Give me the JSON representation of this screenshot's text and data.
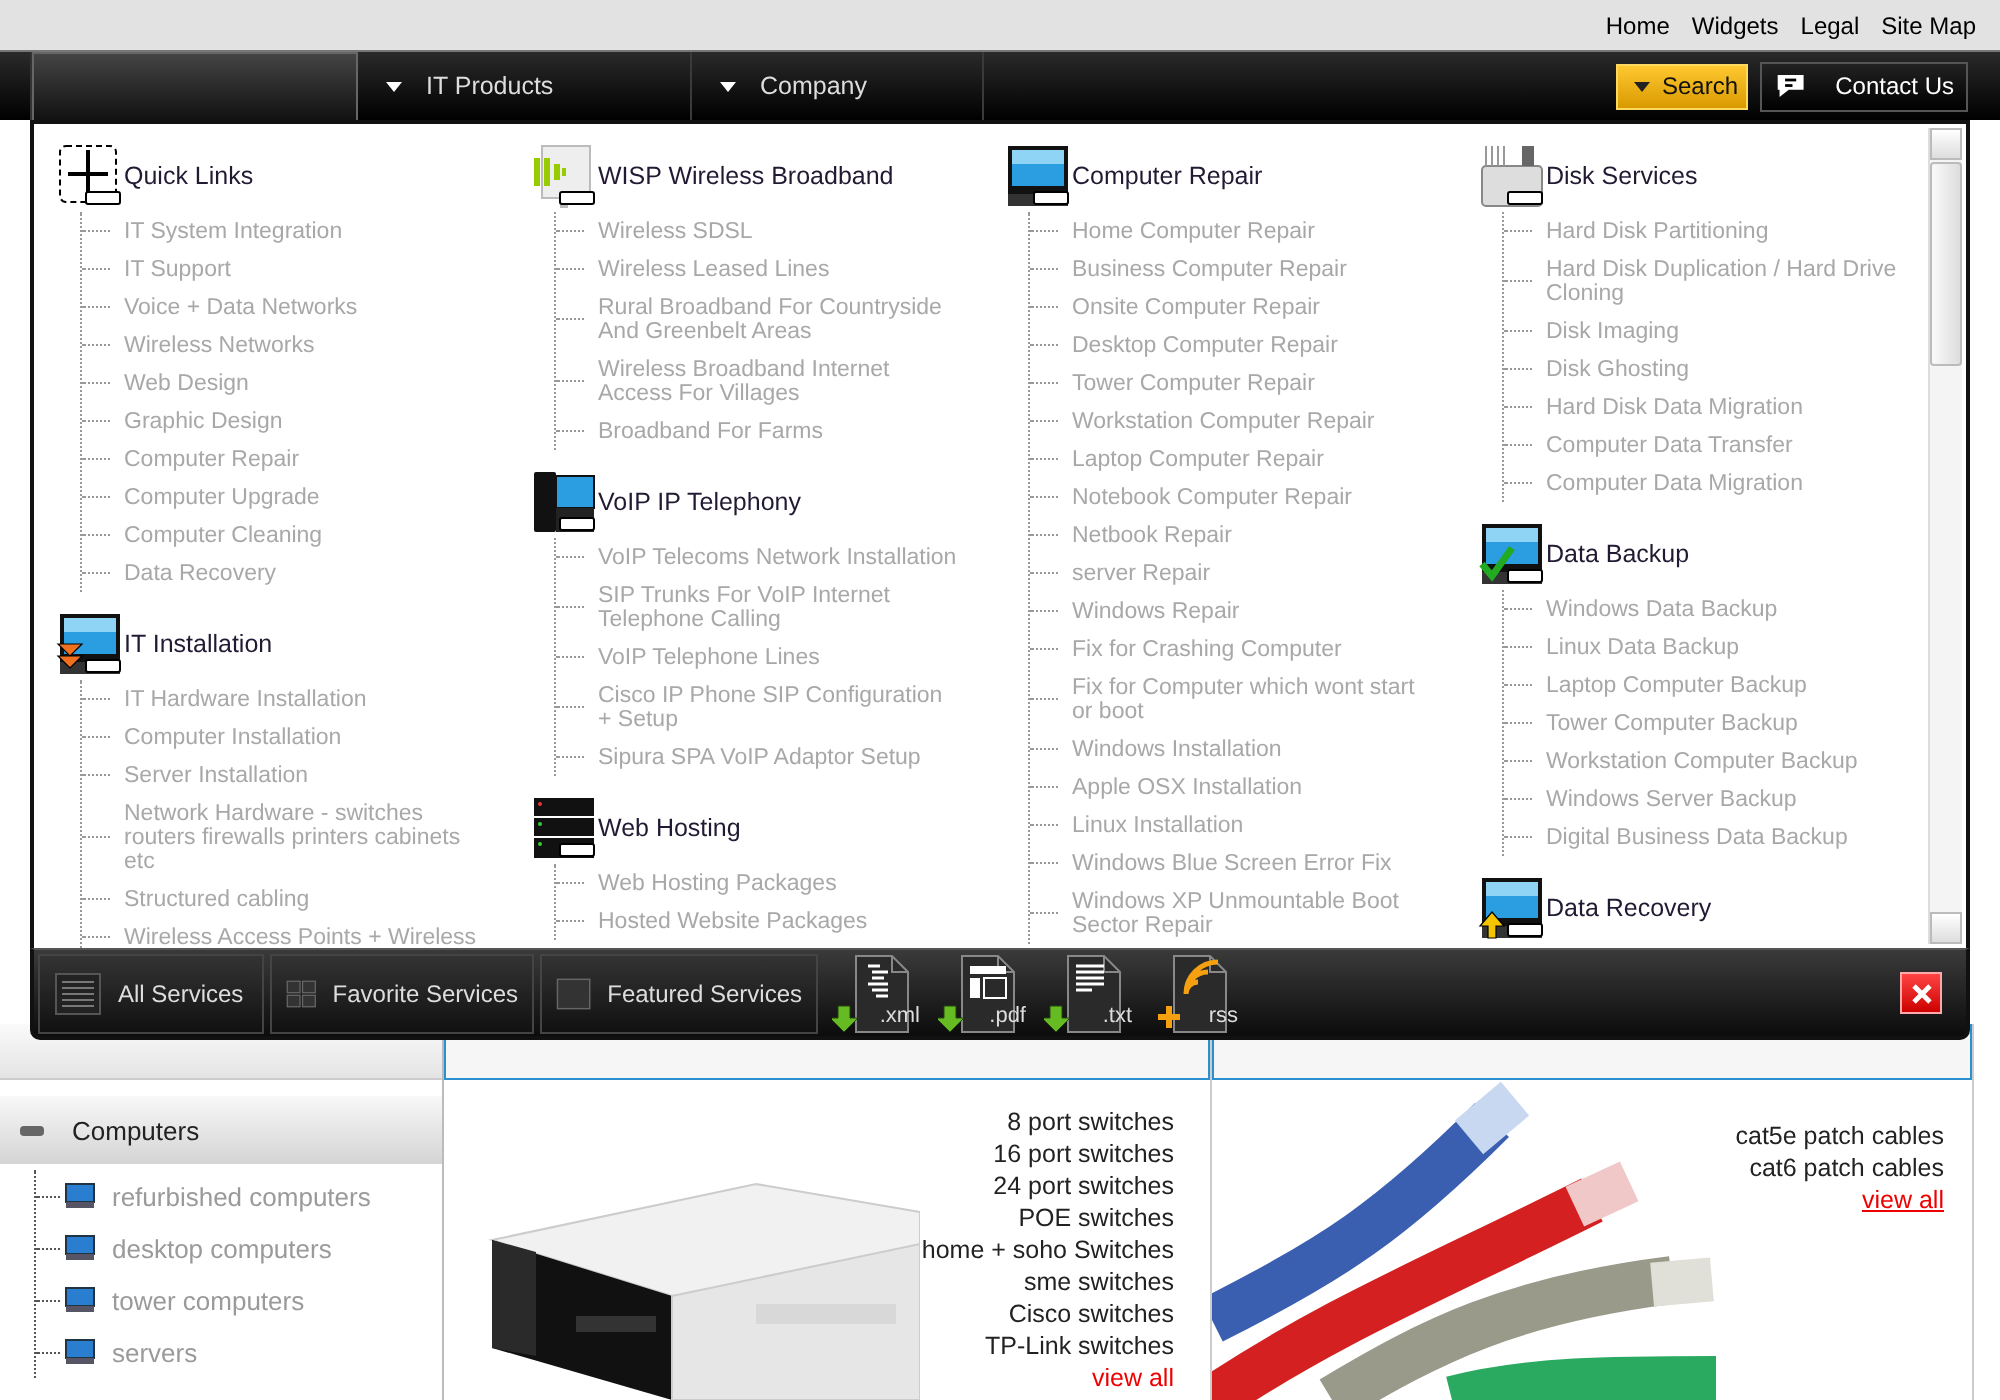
{
  "top_links": [
    "Home",
    "Widgets",
    "Legal",
    "Site Map"
  ],
  "nav": {
    "tabs": [
      {
        "selected": true
      },
      {
        "label": "IT Products",
        "selected": false
      },
      {
        "label": "Company",
        "selected": false
      }
    ],
    "search_button": "Search",
    "contact_button": "Contact Us"
  },
  "menu": {
    "columns": [
      [
        {
          "kind": "links",
          "title": "Quick Links",
          "items": [
            "IT System Integration",
            "IT Support",
            "Voice + Data Networks",
            "Wireless Networks",
            "Web Design",
            "Graphic Design",
            "Computer Repair",
            "Computer Upgrade",
            "Computer Cleaning",
            "Data Recovery"
          ]
        },
        {
          "kind": "install",
          "title": "IT Installation",
          "items": [
            "IT Hardware Installation",
            "Computer Installation",
            "Server Installation",
            "Network Hardware - switches routers firewalls printers cabinets etc",
            "Structured cabling",
            "Wireless Access Points + Wireless"
          ]
        }
      ],
      [
        {
          "kind": "wireless",
          "title": "WISP Wireless Broadband",
          "items": [
            "Wireless SDSL",
            "Wireless Leased Lines",
            "Rural Broadband For Countryside And Greenbelt Areas",
            "Wireless Broadband Internet Access For Villages",
            "Broadband For Farms"
          ]
        },
        {
          "kind": "phone",
          "title": "VoIP IP Telephony",
          "items": [
            "VoIP Telecoms Network Installation",
            "SIP Trunks For VoIP Internet Telephone Calling",
            "VoIP Telephone Lines",
            "Cisco IP Phone SIP Configuration + Setup",
            "Sipura SPA VoIP Adaptor Setup"
          ]
        },
        {
          "kind": "server",
          "title": "Web Hosting",
          "items": [
            "Web Hosting Packages",
            "Hosted Website Packages"
          ]
        }
      ],
      [
        {
          "kind": "monitor",
          "title": "Computer Repair",
          "items": [
            "Home Computer Repair",
            "Business Computer Repair",
            "Onsite Computer Repair",
            "Desktop Computer Repair",
            "Tower Computer Repair",
            "Workstation Computer Repair",
            "Laptop Computer Repair",
            "Notebook Computer Repair",
            "Netbook Repair",
            "server Repair",
            "Windows Repair",
            "Fix for Crashing Computer",
            "Fix for Computer which wont start or boot",
            "Windows Installation",
            "Apple OSX Installation",
            "Linux Installation",
            "Windows Blue Screen Error Fix",
            "Windows XP Unmountable Boot Sector Repair"
          ]
        }
      ],
      [
        {
          "kind": "disk",
          "title": "Disk Services",
          "items": [
            "Hard Disk Partitioning",
            "Hard Disk Duplication / Hard Drive Cloning",
            "Disk Imaging",
            "Disk Ghosting",
            "Hard Disk Data Migration",
            "Computer Data Transfer",
            "Computer Data Migration"
          ]
        },
        {
          "kind": "backup",
          "title": "Data Backup",
          "items": [
            "Windows Data Backup",
            "Linux Data Backup",
            "Laptop Computer Backup",
            "Tower Computer Backup",
            "Workstation Computer Backup",
            "Windows Server Backup",
            "Digital Business Data Backup"
          ]
        },
        {
          "kind": "recovery",
          "title": "Data Recovery"
        }
      ]
    ]
  },
  "toolbar": {
    "buttons": [
      {
        "kind": "all",
        "label": "All Services"
      },
      {
        "kind": "favorite",
        "label": "Favorite Services"
      },
      {
        "kind": "featured",
        "label": "Featured Services"
      }
    ],
    "exports": [
      {
        "kind": "xml",
        "label": ".xml"
      },
      {
        "kind": "pdf",
        "label": ".pdf"
      },
      {
        "kind": "txt",
        "label": ".txt"
      },
      {
        "kind": "rss",
        "label": "rss"
      }
    ]
  },
  "sidebar": {
    "title": "Computers",
    "expanded": true,
    "items": [
      "refurbished computers",
      "desktop computers",
      "tower computers",
      "servers"
    ]
  },
  "panels": [
    {
      "kind": "switches",
      "links": [
        "8 port switches",
        "16 port switches",
        "24 port switches",
        "POE switches",
        "home + soho Switches",
        "sme switches",
        "Cisco switches",
        "TP-Link switches"
      ],
      "view_all": {
        "label": "view all",
        "underlined": false
      }
    },
    {
      "kind": "cables",
      "links": [
        "cat5e patch cables",
        "cat6 patch cables"
      ],
      "view_all": {
        "label": "view all",
        "underlined": true
      }
    }
  ]
}
